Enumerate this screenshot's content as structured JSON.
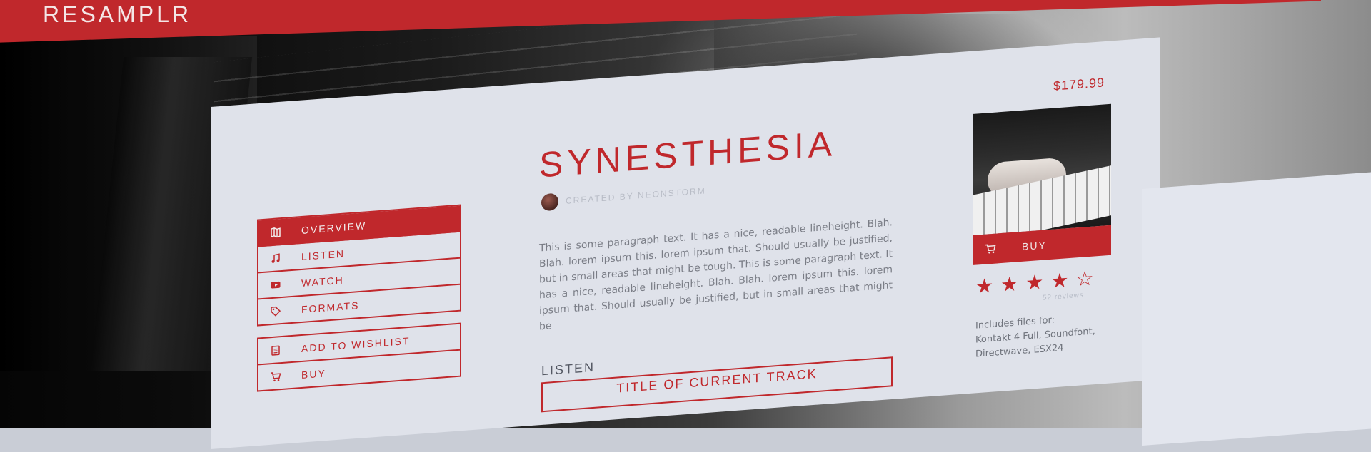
{
  "brand": "RESAMPLR",
  "product": {
    "title": "SYNESTHESIA",
    "created_by": "CREATED BY NEONSTORM",
    "description": "This is some paragraph text.  It has a nice, readable lineheight.  Blah. Blah. lorem ipsum this. lorem ipsum that.  Should usually be justified, but in small areas that might be tough.  This is some paragraph text.  It has a nice, readable lineheight.  Blah. Blah. lorem ipsum this. lorem ipsum that.  Should usually be justified, but in small areas that might be",
    "price": "$179.99",
    "rating": {
      "filled": 4,
      "total": 5,
      "reviews_text": "52 reviews"
    },
    "includes_label": "Includes files for:",
    "includes_formats": "Kontakt 4 Full, Soundfont, Directwave, ESX24"
  },
  "nav": {
    "items": [
      {
        "label": "OVERVIEW",
        "icon": "map-icon",
        "active": true
      },
      {
        "label": "LISTEN",
        "icon": "music-note-icon",
        "active": false
      },
      {
        "label": "WATCH",
        "icon": "youtube-play-icon",
        "active": false
      },
      {
        "label": "FORMATS",
        "icon": "tag-icon",
        "active": false
      }
    ]
  },
  "actions": {
    "items": [
      {
        "label": "ADD TO WISHLIST",
        "icon": "clipboard-list-icon"
      },
      {
        "label": "BUY",
        "icon": "cart-icon"
      }
    ]
  },
  "listen": {
    "label": "LISTEN",
    "current_track": "TITLE OF CURRENT TRACK"
  },
  "buy_button": {
    "label": "BUY",
    "icon": "cart-icon"
  },
  "colors": {
    "accent": "#c0282c",
    "panel": "#dfe2ea",
    "text_muted": "#7a7d86"
  }
}
